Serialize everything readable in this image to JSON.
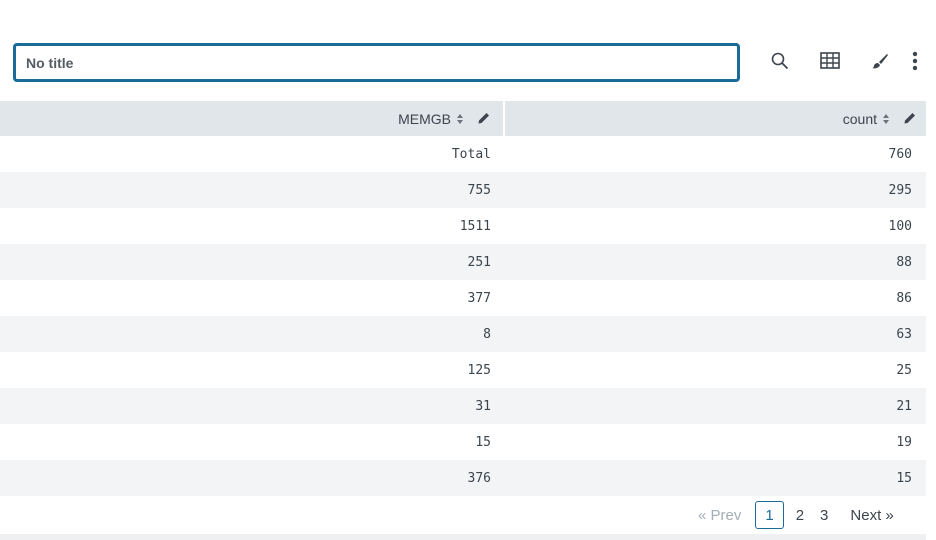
{
  "panel": {
    "title_placeholder": "No title"
  },
  "toolbar": {
    "icons": [
      "search-icon",
      "table-icon",
      "paintbrush-icon",
      "more-vertical-icon"
    ]
  },
  "table": {
    "columns": [
      {
        "label": "MEMGB"
      },
      {
        "label": "count"
      }
    ],
    "rows": [
      [
        "Total",
        "760"
      ],
      [
        "755",
        "295"
      ],
      [
        "1511",
        "100"
      ],
      [
        "251",
        "88"
      ],
      [
        "377",
        "86"
      ],
      [
        "8",
        "63"
      ],
      [
        "125",
        "25"
      ],
      [
        "31",
        "21"
      ],
      [
        "15",
        "19"
      ],
      [
        "376",
        "15"
      ]
    ]
  },
  "pagination": {
    "prev_label": "« Prev",
    "pages": [
      "1",
      "2",
      "3"
    ],
    "current_page": "1",
    "next_label": "Next »"
  },
  "colors": {
    "accent": "#1a6b97",
    "header_bg": "#e1e6eb",
    "stripe_bg": "#f2f4f5",
    "text": "#3c444d",
    "disabled": "#a5adb5"
  }
}
